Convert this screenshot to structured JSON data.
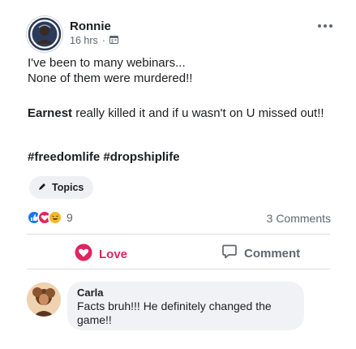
{
  "post": {
    "author": "Ronnie",
    "time": "16 hrs",
    "separator": "·",
    "privacy_icon": "calendar-icon",
    "more_icon": "more-options-icon",
    "body_line1": "I've been to many webinars...",
    "body_line2": "None of them were murdered!!",
    "body2_name": "Earnest",
    "body2_rest": " really killed it and if u wasn't on U missed out!!",
    "hashtags": "#freedomlife #dropshiplife",
    "topics_label": "Topics"
  },
  "reactions": {
    "icons": [
      "like-reaction-icon",
      "love-reaction-icon",
      "haha-reaction-icon"
    ],
    "count": "9",
    "comments_count": "3 Comments"
  },
  "actions": {
    "love_label": "Love",
    "comment_label": "Comment"
  },
  "comment": {
    "name": "Carla",
    "text": "Facts bruh!!! He definitely changed the game!!"
  },
  "colors": {
    "love": "#e0245e",
    "like": "#1877f2",
    "haha": "#f7b928",
    "secondary_text": "#606770",
    "bubble": "#f0f2f5"
  }
}
